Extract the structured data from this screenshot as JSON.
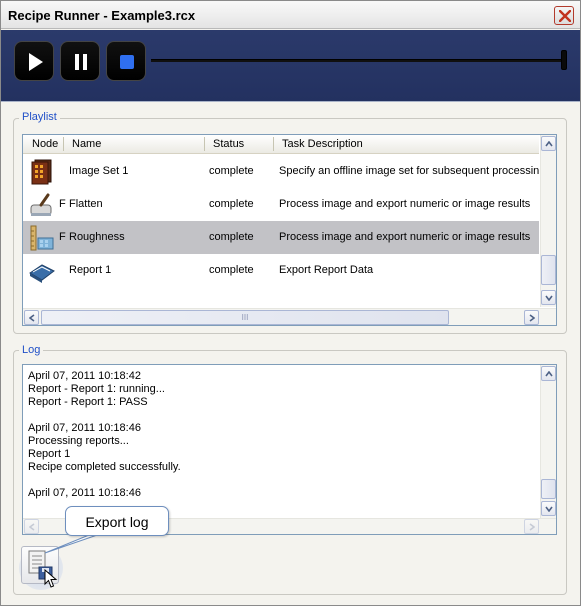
{
  "window": {
    "title": "Recipe Runner - Example3.rcx",
    "close_icon": "close-icon"
  },
  "toolbar": {
    "buttons": [
      "play-icon",
      "pause-icon",
      "stop-icon"
    ],
    "stop_color": "#2f6ff0",
    "progress": 1.0
  },
  "playlist": {
    "label": "Playlist",
    "columns": [
      "Node",
      "Name",
      "Status",
      "Task Description"
    ],
    "rows": [
      {
        "icon": "image-set-icon",
        "flag": "",
        "name": "Image Set 1",
        "status": "complete",
        "description": "Specify an offline image set for subsequent processing"
      },
      {
        "icon": "flatten-icon",
        "flag": "F",
        "name": "Flatten",
        "status": "complete",
        "description": "Process image and export numeric or image results"
      },
      {
        "icon": "roughness-icon",
        "flag": "F",
        "name": "Roughness",
        "status": "complete",
        "description": "Process image and export numeric or image results",
        "selected": true
      },
      {
        "icon": "report-icon",
        "flag": "",
        "name": "Report 1",
        "status": "complete",
        "description": "Export Report Data"
      }
    ],
    "scroll_thumb_glyph": "III"
  },
  "log": {
    "label": "Log",
    "lines": [
      "April 07, 2011 10:18:42",
      "Report - Report 1: running...",
      "Report - Report 1: PASS",
      "",
      "April 07, 2011 10:18:46",
      "Processing reports...",
      "Report 1",
      "Recipe completed successfully.",
      "",
      "April 07, 2011 10:18:46"
    ]
  },
  "export": {
    "tooltip": "Export log",
    "icon": "export-log-icon"
  }
}
